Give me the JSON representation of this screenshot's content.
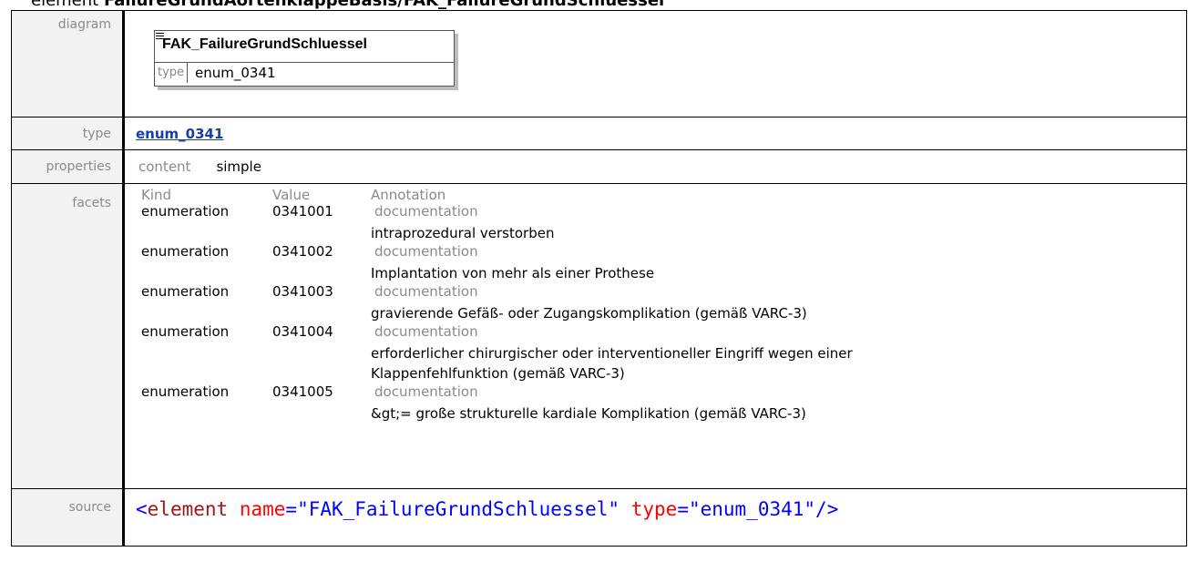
{
  "heading": {
    "prefix": "element ",
    "name": "FailureGrundAortenklappeBasis/FAK_FailureGrundSchluessel"
  },
  "labels": {
    "diagram": "diagram",
    "type": "type",
    "properties": "properties",
    "facets": "facets",
    "source": "source"
  },
  "diagram": {
    "title": "FAK_FailureGrundSchluessel",
    "type_key": "type",
    "type_value": "enum_0341"
  },
  "type": {
    "link_text": "enum_0341"
  },
  "properties": {
    "key": "content",
    "value": "simple"
  },
  "facets": {
    "headers": [
      "Kind",
      "Value",
      "Annotation"
    ],
    "rows": [
      {
        "kind": "enumeration",
        "value": "0341001",
        "annotation": "documentation",
        "doc": [
          "intraprozedural verstorben"
        ]
      },
      {
        "kind": "enumeration",
        "value": "0341002",
        "annotation": "documentation",
        "doc": [
          "Implantation von mehr als einer Prothese"
        ]
      },
      {
        "kind": "enumeration",
        "value": "0341003",
        "annotation": "documentation",
        "doc": [
          "gravierende Gefäß- oder Zugangskomplikation (gemäß VARC-3)"
        ]
      },
      {
        "kind": "enumeration",
        "value": "0341004",
        "annotation": "documentation",
        "doc": [
          "erforderlicher chirurgischer oder interventioneller Eingriff wegen einer",
          "Klappenfehlfunktion (gemäß VARC-3)"
        ]
      },
      {
        "kind": "enumeration",
        "value": "0341005",
        "annotation": "documentation",
        "doc": [
          "&gt;= große strukturelle kardiale Komplikation (gemäß VARC-3)"
        ]
      }
    ]
  },
  "source": {
    "open": "<",
    "tag": "element",
    "attr1": "name",
    "eq1": "=",
    "val1": "\"FAK_FailureGrundSchluessel\"",
    "attr2": "type",
    "eq2": "=",
    "val2": "\"enum_0341\"",
    "close": "/>"
  }
}
